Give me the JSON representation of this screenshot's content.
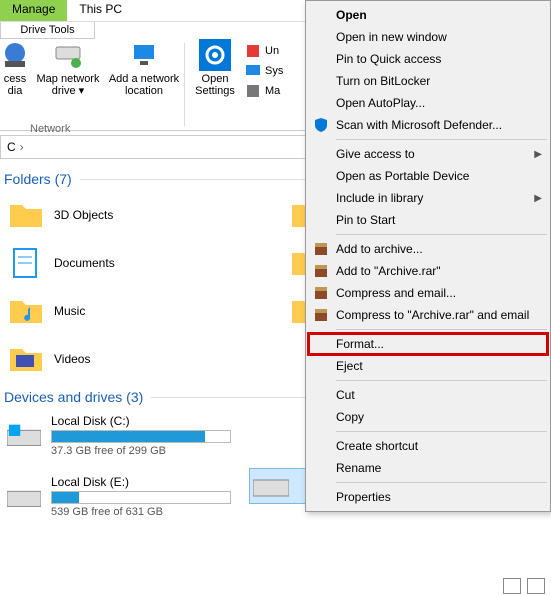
{
  "tabs": {
    "manage": "Manage",
    "thispc": "This PC",
    "drivetools": "Drive Tools"
  },
  "ribbon": {
    "media": {
      "label1": "cess",
      "label2": "dia",
      "drop": "▾"
    },
    "mapnet": {
      "label": "Map network\ndrive",
      "drop": "▾"
    },
    "addnet": {
      "label": "Add a network\nlocation"
    },
    "group_network": "Network",
    "opensettings": {
      "label": "Open\nSettings"
    },
    "small": {
      "uninstall": "Un",
      "system": "Sys",
      "manage": "Ma"
    }
  },
  "breadcrumb": {
    "root": "C",
    "sep": "›"
  },
  "sections": {
    "folders": {
      "title": "Folders (7)",
      "items": [
        "3D Objects",
        "Documents",
        "Music",
        "Videos"
      ]
    },
    "drives": {
      "title": "Devices and drives (3)",
      "list": [
        {
          "name": "Local Disk (C:)",
          "free": "37.3 GB free of 299 GB",
          "pct": 86
        },
        {
          "name": "Local Disk (E:)",
          "free": "539 GB free of 631 GB",
          "pct": 15
        }
      ],
      "selected_sub": "  "
    }
  },
  "ctx": {
    "open": "Open",
    "openwin": "Open in new window",
    "pinquick": "Pin to Quick access",
    "bitlocker": "Turn on BitLocker",
    "autoplay": "Open AutoPlay...",
    "defender": "Scan with Microsoft Defender...",
    "giveaccess": "Give access to",
    "portable": "Open as Portable Device",
    "library": "Include in library",
    "pinstart": "Pin to Start",
    "addarchive": "Add to archive...",
    "addrar": "Add to \"Archive.rar\"",
    "compressemail": "Compress and email...",
    "compressrar": "Compress to \"Archive.rar\" and email",
    "format": "Format...",
    "eject": "Eject",
    "cut": "Cut",
    "copy": "Copy",
    "shortcut": "Create shortcut",
    "rename": "Rename",
    "properties": "Properties"
  }
}
